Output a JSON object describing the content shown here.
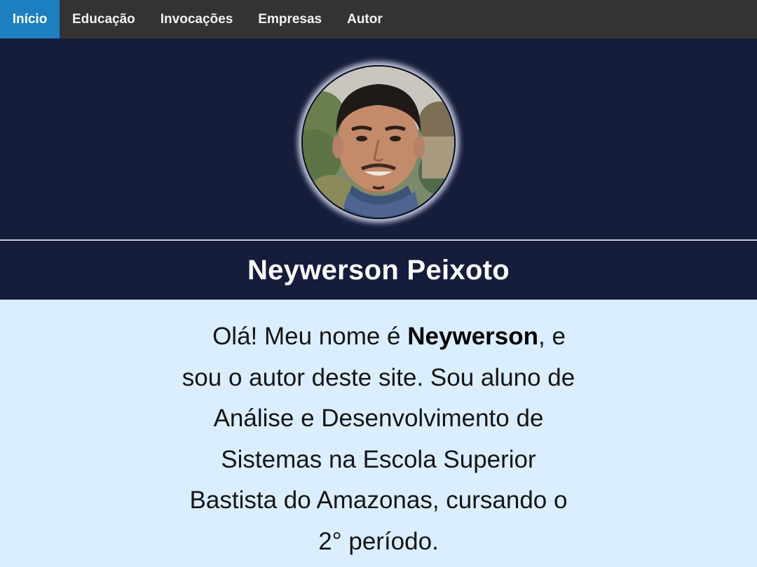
{
  "nav": {
    "items": [
      {
        "label": "Início",
        "active": true
      },
      {
        "label": "Educação",
        "active": false
      },
      {
        "label": "Invocações",
        "active": false
      },
      {
        "label": "Empresas",
        "active": false
      },
      {
        "label": "Autor",
        "active": false
      }
    ]
  },
  "profile": {
    "name": "Neywerson Peixoto"
  },
  "intro": {
    "part1": "Olá! Meu nome é ",
    "highlight": "Neywerson",
    "part2": ", e sou o autor deste site. Sou aluno de Análise e Desenvolvimento de Sistemas na Escola Superior Bastista do Amazonas, cursando o 2° período."
  },
  "colors": {
    "nav_bg": "#333333",
    "nav_active": "#1c7fc0",
    "banner_bg": "#151d3b",
    "content_bg": "#daeeff"
  }
}
